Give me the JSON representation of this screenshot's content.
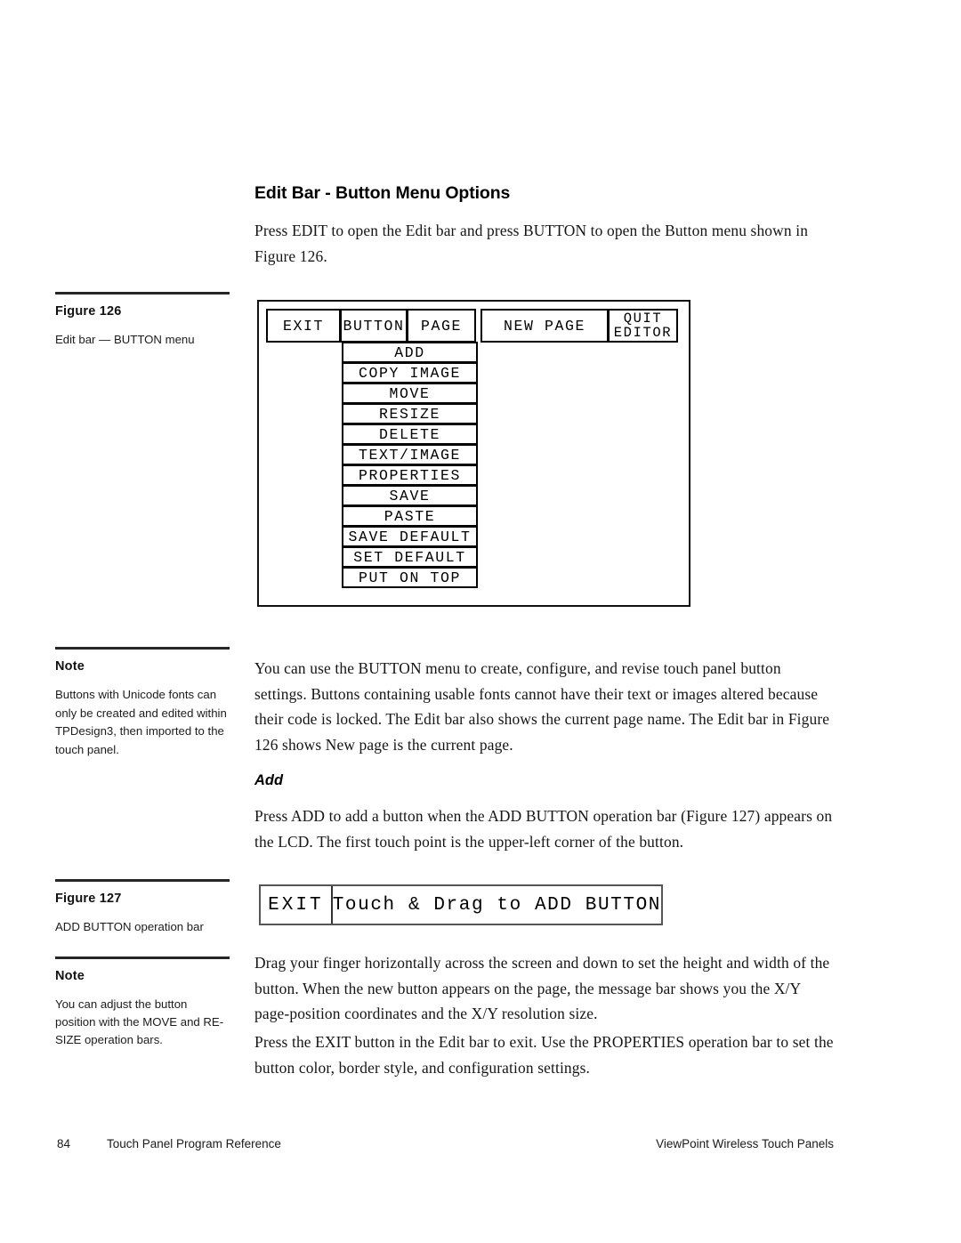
{
  "document": {
    "section_title": "Edit Bar - Button Menu Options",
    "intro_paragraph": "Press EDIT to open the Edit bar and press BUTTON to open the Button menu shown in Figure 126.",
    "body_paragraph_1": "You can use the BUTTON menu to create, configure, and revise touch panel button settings. Buttons containing usable fonts cannot have their text or images altered because their code is locked. The Edit bar also shows the current page name. The Edit bar in Figure 126 shows New page is the current page.",
    "sub_title": "Add",
    "body_paragraph_2": "Press ADD to add a button when the ADD BUTTON operation bar (Figure 127) appears on the LCD. The first touch point is the upper-left corner of the button.",
    "body_paragraph_3": "Drag your finger horizontally across the screen and down to set the height and width of the button. When the new button appears on the page, the message bar shows you the X/Y page-position coordinates and the X/Y resolution size.",
    "body_paragraph_4": "Press the EXIT button in the Edit bar to exit. Use the PROPERTIES operation bar to set the button color, border style, and configuration settings."
  },
  "sidebar": {
    "figure_126": {
      "heading": "Figure 126",
      "caption": "Edit bar — BUTTON menu"
    },
    "note_1": {
      "heading": "Note",
      "text": "Buttons with Unicode fonts can only be created and edited within TPDesign3, then imported to the touch panel."
    },
    "figure_127": {
      "heading": "Figure 127",
      "caption": "ADD BUTTON operation bar"
    },
    "note_2": {
      "heading": "Note",
      "text": "You can adjust the button position with the MOVE and RE-SIZE operation bars."
    }
  },
  "figure_126": {
    "edit_bar": {
      "exit": "EXIT",
      "button": "BUTTON",
      "page": "PAGE",
      "current_page": "NEW PAGE",
      "quit_editor_line1": "QUIT",
      "quit_editor_line2": "EDITOR"
    },
    "button_menu_items": [
      "ADD",
      "COPY IMAGE",
      "MOVE",
      "RESIZE",
      "DELETE",
      "TEXT/IMAGE",
      "PROPERTIES",
      "SAVE",
      "PASTE",
      "SAVE DEFAULT",
      "SET DEFAULT",
      "PUT ON TOP"
    ]
  },
  "figure_127": {
    "exit_label": "EXIT",
    "message": "Touch & Drag to ADD BUTTON"
  },
  "footer": {
    "page_number": "84",
    "left_text": "Touch Panel Program Reference",
    "right_text": "ViewPoint Wireless Touch Panels"
  },
  "colors": {
    "ink": "#111111",
    "rule": "#262626",
    "background": "#ffffff"
  }
}
